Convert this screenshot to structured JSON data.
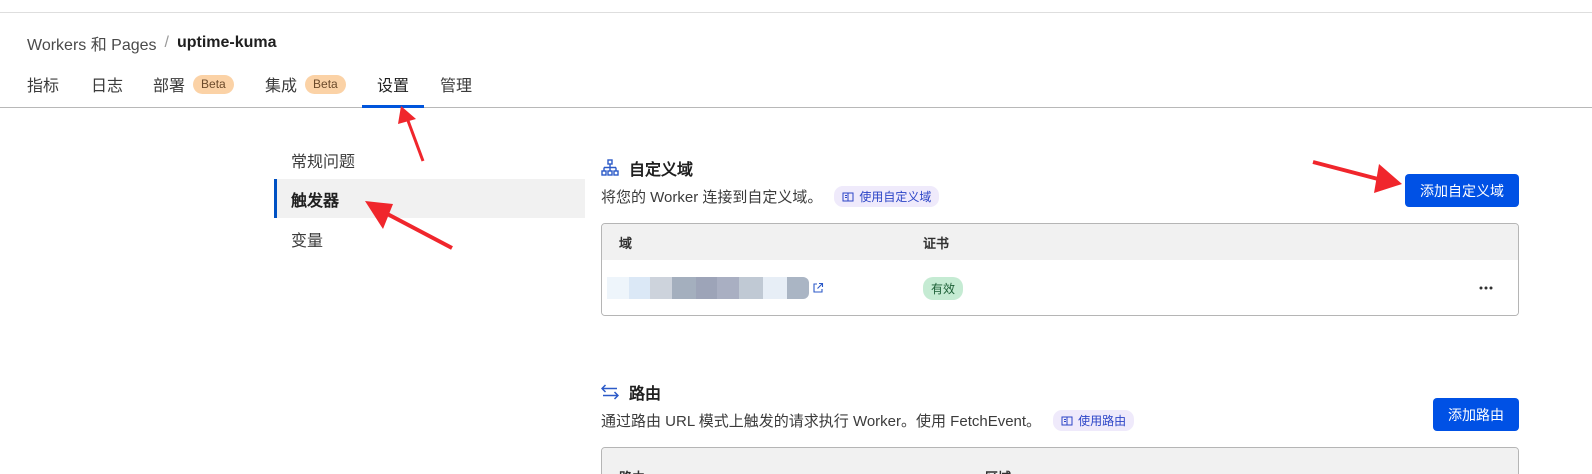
{
  "breadcrumb": {
    "parent": "Workers 和 Pages",
    "separator": "/",
    "current": "uptime-kuma"
  },
  "tabs": [
    {
      "label": "指标"
    },
    {
      "label": "日志"
    },
    {
      "label": "部署",
      "badge": "Beta"
    },
    {
      "label": "集成",
      "badge": "Beta"
    },
    {
      "label": "设置",
      "active": true
    },
    {
      "label": "管理"
    }
  ],
  "side_nav": [
    {
      "label": "常规问题"
    },
    {
      "label": "触发器",
      "active": true
    },
    {
      "label": "变量"
    }
  ],
  "custom_domains": {
    "icon": "sitemap-icon",
    "title": "自定义域",
    "description": "将您的 Worker 连接到自定义域。",
    "doc_link": "使用自定义域",
    "add_button": "添加自定义域",
    "table": {
      "headers": [
        "域",
        "证书"
      ],
      "rows": [
        {
          "domain": "",
          "certificate": "有效"
        }
      ]
    }
  },
  "routes": {
    "icon": "swap-arrows-icon",
    "title": "路由",
    "description": "通过路由 URL 模式上触发的请求执行 Worker。使用 FetchEvent。",
    "doc_link": "使用路由",
    "add_button": "添加路由",
    "table": {
      "headers": [
        "路由",
        "区域"
      ]
    }
  },
  "colors": {
    "accent": "#0051e5",
    "tab_underline": "#0055dc",
    "annotation_arrow": "#f0262c",
    "beta_badge": "#fbd2a6",
    "status_ok": "#c5ebd3"
  }
}
